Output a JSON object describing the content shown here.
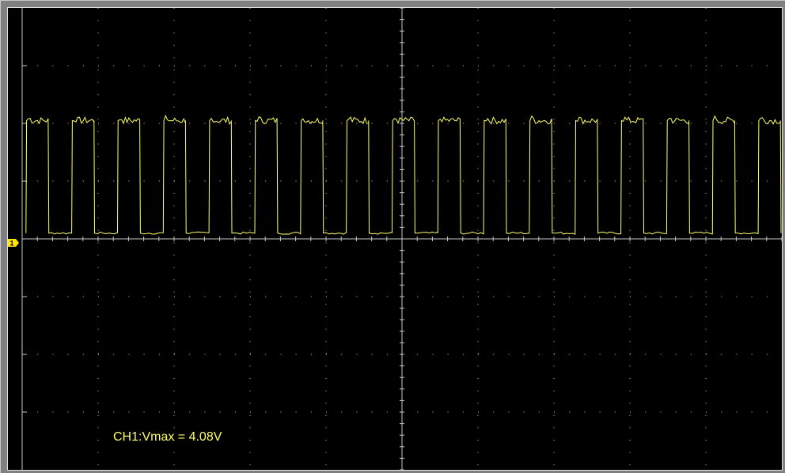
{
  "colors": {
    "background": "#000000",
    "frame": "#808080",
    "grid": "#c8c8c8",
    "trace": "#ffff66",
    "marker_fill": "#ffe600",
    "marker_text": "#000000"
  },
  "channel_marker": {
    "label": "1",
    "icon": "channel-1-ground-marker-icon"
  },
  "measurement": {
    "text": "CH1:Vmax = 4.08V"
  },
  "chart_data": {
    "type": "line",
    "title": "",
    "xlabel": "",
    "ylabel": "",
    "grid": true,
    "xlim": [
      0,
      10
    ],
    "ylim": [
      -4,
      4
    ],
    "series": [
      {
        "waveform": "square",
        "low": 0.1,
        "high": 2.05,
        "periods_visible": 16.6,
        "duty_cycle": 0.5
      }
    ]
  }
}
